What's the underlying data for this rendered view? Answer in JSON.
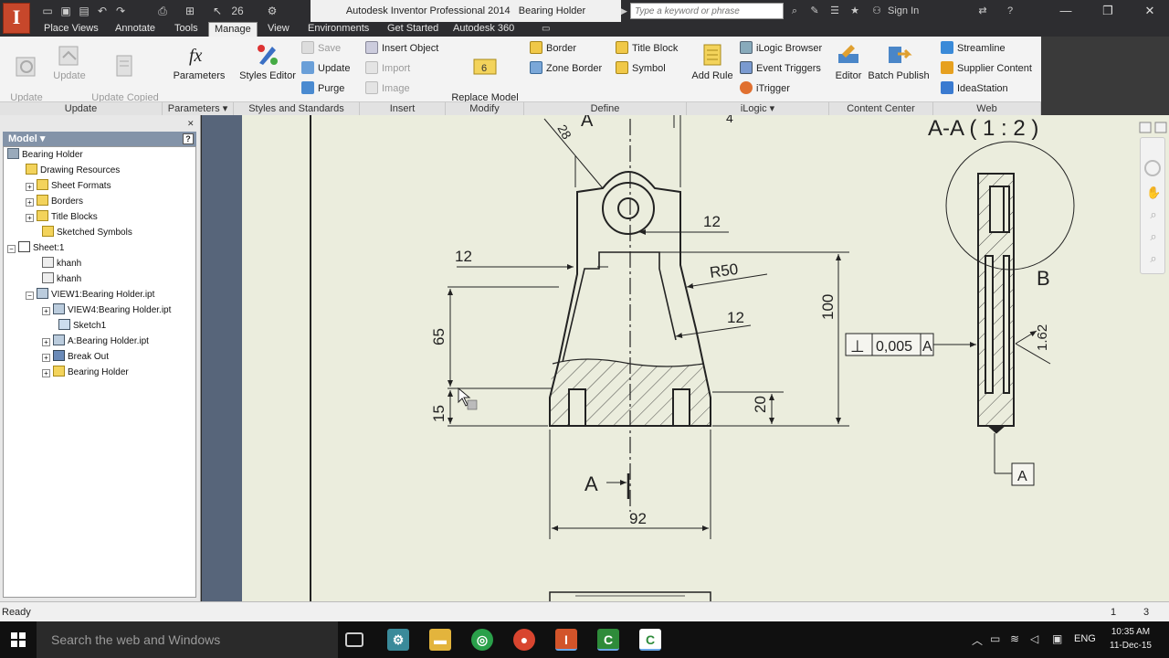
{
  "title_bar": {
    "app_title": "Autodesk Inventor Professional 2014",
    "doc_title": "Bearing Holder",
    "search_placeholder": "Type a keyword or phrase",
    "sign_in": "Sign In",
    "qat_zoom": "26"
  },
  "tabs": [
    "Place Views",
    "Annotate",
    "Tools",
    "Manage",
    "View",
    "Environments",
    "Get Started",
    "Autodesk 360"
  ],
  "active_tab": "Manage",
  "ribbon": {
    "update_panel": {
      "title": "Update",
      "update_all": "Update\nAll Sheets",
      "update": "Update",
      "update_copied": "Update Copied\nProperties"
    },
    "parameters_panel": {
      "title": "Parameters ▾",
      "parameters": "Parameters"
    },
    "styles_panel": {
      "title": "Styles and Standards",
      "styles_editor": "Styles Editor",
      "save": "Save",
      "update": "Update",
      "purge": "Purge"
    },
    "insert_panel": {
      "title": "Insert",
      "insert_object": "Insert Object",
      "import": "Import",
      "image": "Image"
    },
    "modify_panel": {
      "title": "Modify",
      "replace": "Replace Model\nReference"
    },
    "define_panel": {
      "title": "Define",
      "border": "Border",
      "zone_border": "Zone Border",
      "title_block": "Title Block",
      "symbol": "Symbol"
    },
    "ilogic_panel": {
      "title": "iLogic ▾",
      "add_rule": "Add Rule",
      "browser": "iLogic Browser",
      "event_triggers": "Event Triggers",
      "itrigger": "iTrigger"
    },
    "content_panel": {
      "title": "Content Center",
      "editor": "Editor",
      "batch_publish": "Batch Publish"
    },
    "web_panel": {
      "title": "Web",
      "streamline": "Streamline",
      "supplier_content": "Supplier Content",
      "ideastation": "IdeaStation"
    }
  },
  "browser": {
    "header": "Model ▾",
    "help": "?",
    "root": "Bearing Holder",
    "nodes": [
      {
        "label": "Drawing Resources"
      },
      {
        "label": "Sheet Formats"
      },
      {
        "label": "Borders"
      },
      {
        "label": "Title Blocks"
      },
      {
        "label": "Sketched Symbols"
      },
      {
        "label": "Sheet:1"
      },
      {
        "label": "khanh"
      },
      {
        "label": "khanh"
      },
      {
        "label": "VIEW1:Bearing Holder.ipt"
      },
      {
        "label": "VIEW4:Bearing Holder.ipt"
      },
      {
        "label": "Sketch1"
      },
      {
        "label": "A:Bearing Holder.ipt"
      },
      {
        "label": "Break Out"
      },
      {
        "label": "Bearing Holder"
      }
    ]
  },
  "drawing": {
    "section_title": "A-A ( 1 : 2 )",
    "section_label_a": "A",
    "detail_label": "B",
    "dims": {
      "d12_top": "12",
      "d12_left": "12",
      "r50": "R50",
      "d12_mid": "12",
      "d65": "65",
      "d15": "15",
      "d100": "100",
      "d20": "20",
      "d92": "92",
      "d28": "28",
      "d4": "4",
      "d162": "1.62"
    },
    "tolerance": {
      "symbol": "⊥",
      "value": "0,005",
      "datum": "A"
    },
    "datum_label": "A"
  },
  "status": {
    "text": "Ready",
    "page_a": "1",
    "page_b": "3"
  },
  "taskbar": {
    "search_placeholder": "Search the web and Windows",
    "lang": "ENG",
    "time": "10:35 AM",
    "date": "11-Dec-15"
  }
}
